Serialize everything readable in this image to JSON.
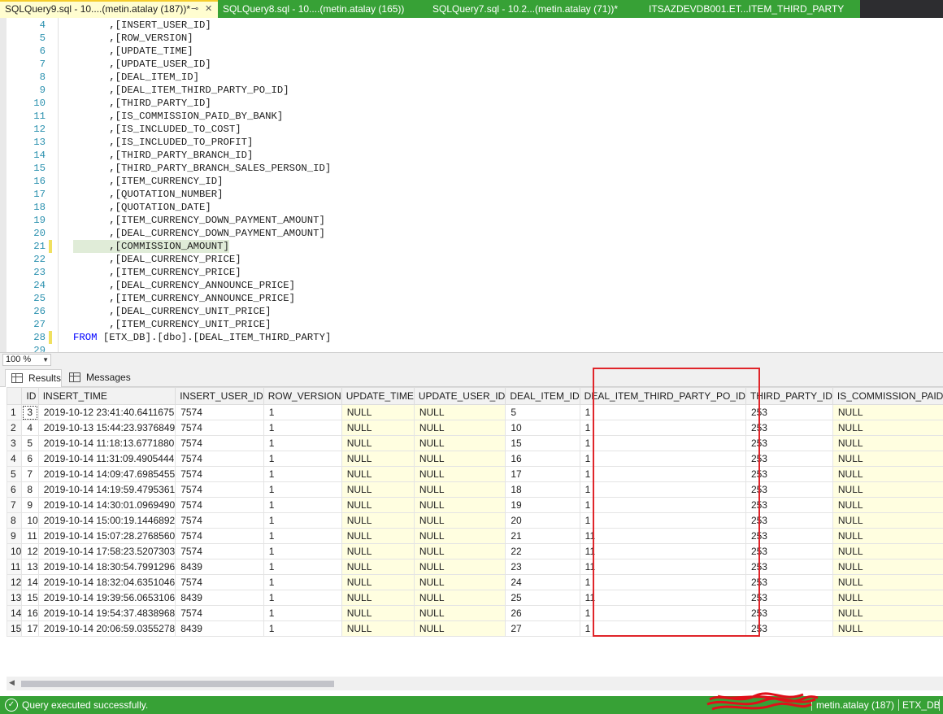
{
  "tabs": [
    {
      "label": "SQLQuery9.sql - 10....(metin.atalay (187))*",
      "active": true
    },
    {
      "label": "SQLQuery8.sql - 10....(metin.atalay (165))",
      "active": false
    },
    {
      "label": "SQLQuery7.sql - 10.2...(metin.atalay (71))*",
      "active": false
    },
    {
      "label": "ITSAZDEVDB001.ET...ITEM_THIRD_PARTY",
      "active": false
    }
  ],
  "tab_icons": {
    "pin": "pin-icon",
    "close": "close-icon"
  },
  "editor": {
    "lines": [
      {
        "num": "4",
        "text": "      ,[INSERT_USER_ID]"
      },
      {
        "num": "5",
        "text": "      ,[ROW_VERSION]"
      },
      {
        "num": "6",
        "text": "      ,[UPDATE_TIME]"
      },
      {
        "num": "7",
        "text": "      ,[UPDATE_USER_ID]"
      },
      {
        "num": "8",
        "text": "      ,[DEAL_ITEM_ID]"
      },
      {
        "num": "9",
        "text": "      ,[DEAL_ITEM_THIRD_PARTY_PO_ID]"
      },
      {
        "num": "10",
        "text": "      ,[THIRD_PARTY_ID]"
      },
      {
        "num": "11",
        "text": "      ,[IS_COMMISSION_PAID_BY_BANK]"
      },
      {
        "num": "12",
        "text": "      ,[IS_INCLUDED_TO_COST]"
      },
      {
        "num": "13",
        "text": "      ,[IS_INCLUDED_TO_PROFIT]"
      },
      {
        "num": "14",
        "text": "      ,[THIRD_PARTY_BRANCH_ID]"
      },
      {
        "num": "15",
        "text": "      ,[THIRD_PARTY_BRANCH_SALES_PERSON_ID]"
      },
      {
        "num": "16",
        "text": "      ,[ITEM_CURRENCY_ID]"
      },
      {
        "num": "17",
        "text": "      ,[QUOTATION_NUMBER]"
      },
      {
        "num": "18",
        "text": "      ,[QUOTATION_DATE]"
      },
      {
        "num": "19",
        "text": "      ,[ITEM_CURRENCY_DOWN_PAYMENT_AMOUNT]"
      },
      {
        "num": "20",
        "text": "      ,[DEAL_CURRENCY_DOWN_PAYMENT_AMOUNT]"
      },
      {
        "num": "21",
        "text": "      ,[COMMISSION_AMOUNT]"
      },
      {
        "num": "22",
        "text": "      ,[DEAL_CURRENCY_PRICE]"
      },
      {
        "num": "23",
        "text": "      ,[ITEM_CURRENCY_PRICE]"
      },
      {
        "num": "24",
        "text": "      ,[DEAL_CURRENCY_ANNOUNCE_PRICE]"
      },
      {
        "num": "25",
        "text": "      ,[ITEM_CURRENCY_ANNOUNCE_PRICE]"
      },
      {
        "num": "26",
        "text": "      ,[DEAL_CURRENCY_UNIT_PRICE]"
      },
      {
        "num": "27",
        "text": "      ,[ITEM_CURRENCY_UNIT_PRICE]"
      },
      {
        "num": "28",
        "keyword": "FROM",
        "text": " [ETX_DB].[dbo].[DEAL_ITEM_THIRD_PARTY]"
      },
      {
        "num": "29",
        "text": ""
      }
    ]
  },
  "zoom": {
    "value": "100 %"
  },
  "results_tabs": {
    "results": "Results",
    "messages": "Messages"
  },
  "grid": {
    "columns": [
      "",
      "ID",
      "INSERT_TIME",
      "INSERT_USER_ID",
      "ROW_VERSION",
      "UPDATE_TIME",
      "UPDATE_USER_ID",
      "DEAL_ITEM_ID",
      "DEAL_ITEM_THIRD_PARTY_PO_ID",
      "THIRD_PARTY_ID",
      "IS_COMMISSION_PAID"
    ],
    "rows": [
      [
        "1",
        "3",
        "2019-10-12 23:41:40.6411675",
        "7574",
        "1",
        "NULL",
        "NULL",
        "5",
        "1",
        "253",
        "NULL"
      ],
      [
        "2",
        "4",
        "2019-10-13 15:44:23.9376849",
        "7574",
        "1",
        "NULL",
        "NULL",
        "10",
        "1",
        "253",
        "NULL"
      ],
      [
        "3",
        "5",
        "2019-10-14 11:18:13.6771880",
        "7574",
        "1",
        "NULL",
        "NULL",
        "15",
        "1",
        "253",
        "NULL"
      ],
      [
        "4",
        "6",
        "2019-10-14 11:31:09.4905444",
        "7574",
        "1",
        "NULL",
        "NULL",
        "16",
        "1",
        "253",
        "NULL"
      ],
      [
        "5",
        "7",
        "2019-10-14 14:09:47.6985455",
        "7574",
        "1",
        "NULL",
        "NULL",
        "17",
        "1",
        "253",
        "NULL"
      ],
      [
        "6",
        "8",
        "2019-10-14 14:19:59.4795361",
        "7574",
        "1",
        "NULL",
        "NULL",
        "18",
        "1",
        "253",
        "NULL"
      ],
      [
        "7",
        "9",
        "2019-10-14 14:30:01.0969490",
        "7574",
        "1",
        "NULL",
        "NULL",
        "19",
        "1",
        "253",
        "NULL"
      ],
      [
        "8",
        "10",
        "2019-10-14 15:00:19.1446892",
        "7574",
        "1",
        "NULL",
        "NULL",
        "20",
        "1",
        "253",
        "NULL"
      ],
      [
        "9",
        "11",
        "2019-10-14 15:07:28.2768560",
        "7574",
        "1",
        "NULL",
        "NULL",
        "21",
        "11",
        "253",
        "NULL"
      ],
      [
        "10",
        "12",
        "2019-10-14 17:58:23.5207303",
        "7574",
        "1",
        "NULL",
        "NULL",
        "22",
        "11",
        "253",
        "NULL"
      ],
      [
        "11",
        "13",
        "2019-10-14 18:30:54.7991296",
        "8439",
        "1",
        "NULL",
        "NULL",
        "23",
        "11",
        "253",
        "NULL"
      ],
      [
        "12",
        "14",
        "2019-10-14 18:32:04.6351046",
        "7574",
        "1",
        "NULL",
        "NULL",
        "24",
        "1",
        "253",
        "NULL"
      ],
      [
        "13",
        "15",
        "2019-10-14 19:39:56.0653106",
        "8439",
        "1",
        "NULL",
        "NULL",
        "25",
        "11",
        "253",
        "NULL"
      ],
      [
        "14",
        "16",
        "2019-10-14 19:54:37.4838968",
        "7574",
        "1",
        "NULL",
        "NULL",
        "26",
        "1",
        "253",
        "NULL"
      ],
      [
        "15",
        "17",
        "2019-10-14 20:06:59.0355278",
        "8439",
        "1",
        "NULL",
        "NULL",
        "27",
        "1",
        "253",
        "NULL"
      ]
    ]
  },
  "status": {
    "message": "Query executed successfully.",
    "user": "metin.atalay (187)",
    "database": "ETX_DB",
    "icon": "check-circle-icon"
  },
  "colors": {
    "status_green": "#37a136",
    "null_bg": "#fffee0",
    "annotation_red": "#e0252a"
  }
}
